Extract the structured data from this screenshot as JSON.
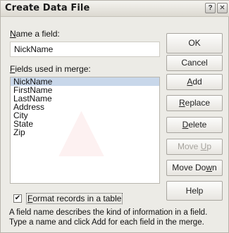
{
  "window": {
    "title": "Create Data File",
    "help_glyph": "?",
    "close_glyph": "✕"
  },
  "name_field": {
    "label": "Name a field:",
    "label_underline": "N",
    "label_rest": "ame a field:",
    "value": "NickName"
  },
  "fields_list": {
    "label": "Fields used in merge:",
    "label_underline": "F",
    "label_rest": "ields used in merge:",
    "items": [
      "NickName",
      "FirstName",
      "LastName",
      "Address",
      "City",
      "State",
      "Zip"
    ],
    "selected_index": 0
  },
  "buttons": {
    "ok": "OK",
    "cancel": "Cancel",
    "add_underline": "A",
    "add_rest": "dd",
    "replace_underline": "R",
    "replace_rest": "eplace",
    "delete_underline": "D",
    "delete_rest": "elete",
    "move_up_pre": "Move ",
    "move_up_underline": "U",
    "move_up_post": "p",
    "move_down_pre": "Move Do",
    "move_down_underline": "w",
    "move_down_post": "n",
    "help": "Help"
  },
  "format_checkbox": {
    "checked": true,
    "check_glyph": "✔",
    "label_underline": "F",
    "label_rest": "ormat records in a table"
  },
  "description": "A field name describes the kind of information in a field. Type a name and click Add for each field in the merge."
}
